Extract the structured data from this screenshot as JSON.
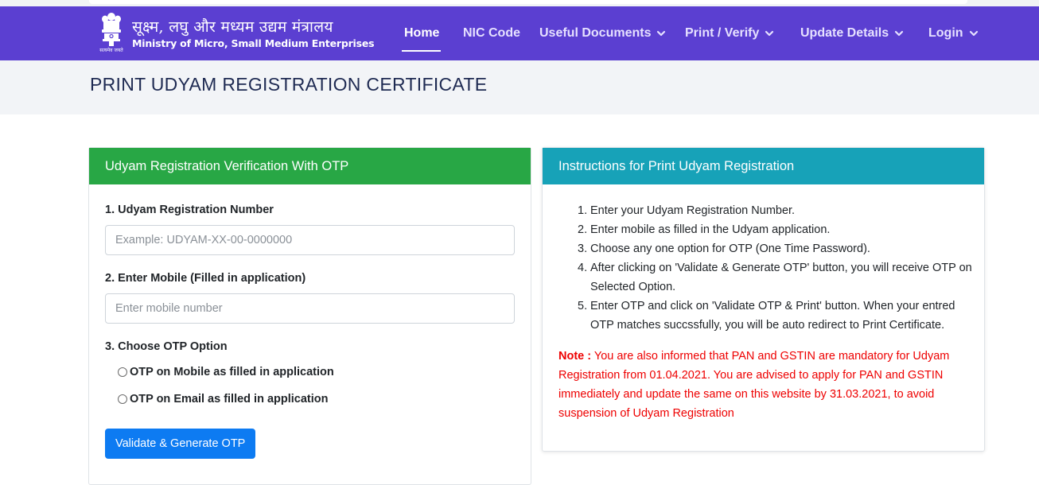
{
  "header": {
    "brand_hindi": "सूक्ष्म, लघु और मध्यम उद्यम मंत्रालय",
    "brand_english": "Ministry of Micro, Small Medium Enterprises",
    "emblem_motto": "सत्यमेव जयते",
    "nav": [
      {
        "label": "Home",
        "active": true,
        "dropdown": false
      },
      {
        "label": "NIC Code",
        "active": false,
        "dropdown": false
      },
      {
        "label": "Useful Documents",
        "active": false,
        "dropdown": true
      },
      {
        "label": "Print / Verify",
        "active": false,
        "dropdown": true
      },
      {
        "label": "Update Details",
        "active": false,
        "dropdown": true
      },
      {
        "label": "Login",
        "active": false,
        "dropdown": true
      }
    ]
  },
  "page": {
    "title": "PRINT UDYAM REGISTRATION CERTIFICATE"
  },
  "form_card": {
    "title": "Udyam Registration Verification With OTP",
    "field1_label": "1. Udyam Registration Number",
    "field1_placeholder": "Example: UDYAM-XX-00-0000000",
    "field1_value": "",
    "field2_label": "2. Enter Mobile (Filled in application)",
    "field2_placeholder": "Enter mobile number",
    "field2_value": "",
    "otp_label": "3. Choose OTP Option",
    "otp_options": [
      {
        "label": "OTP on Mobile as filled in application",
        "checked": false
      },
      {
        "label": "OTP on Email as filled in application",
        "checked": false
      }
    ],
    "submit_label": "Validate & Generate OTP"
  },
  "instructions_card": {
    "title": "Instructions for Print Udyam Registration",
    "steps": [
      {
        "num": "1.",
        "text": "Enter your Udyam Registration Number."
      },
      {
        "num": "2.",
        "text": "Enter mobile as filled in the Udyam application."
      },
      {
        "num": "3.",
        "text": "Choose any one option for OTP (One Time Password)."
      },
      {
        "num": "4.",
        "text": "After clicking on 'Validate & Generate OTP' button, you will receive OTP on Selected Option."
      },
      {
        "num": "5.",
        "text": "Enter OTP and click on 'Validate OTP & Print' button. When your entred OTP matches succssfully, you will be auto redirect to Print Certificate."
      }
    ],
    "note_label": "Note :",
    "note_text": " You are also informed that PAN and GSTIN are mandatory for Udyam Registration from 01.04.2021. You are advised to apply for PAN and GSTIN immediately and update the same on this website by 31.03.2021, to avoid suspension of Udyam Registration"
  },
  "icons": {
    "emblem": "national-emblem-icon",
    "dropdown": "chevron-down-icon"
  },
  "colors": {
    "navbar": "#5b3fd1",
    "form_header": "#28a745",
    "instructions_header": "#17a2b8",
    "button": "#0d7bf2",
    "note": "#ee0000"
  }
}
